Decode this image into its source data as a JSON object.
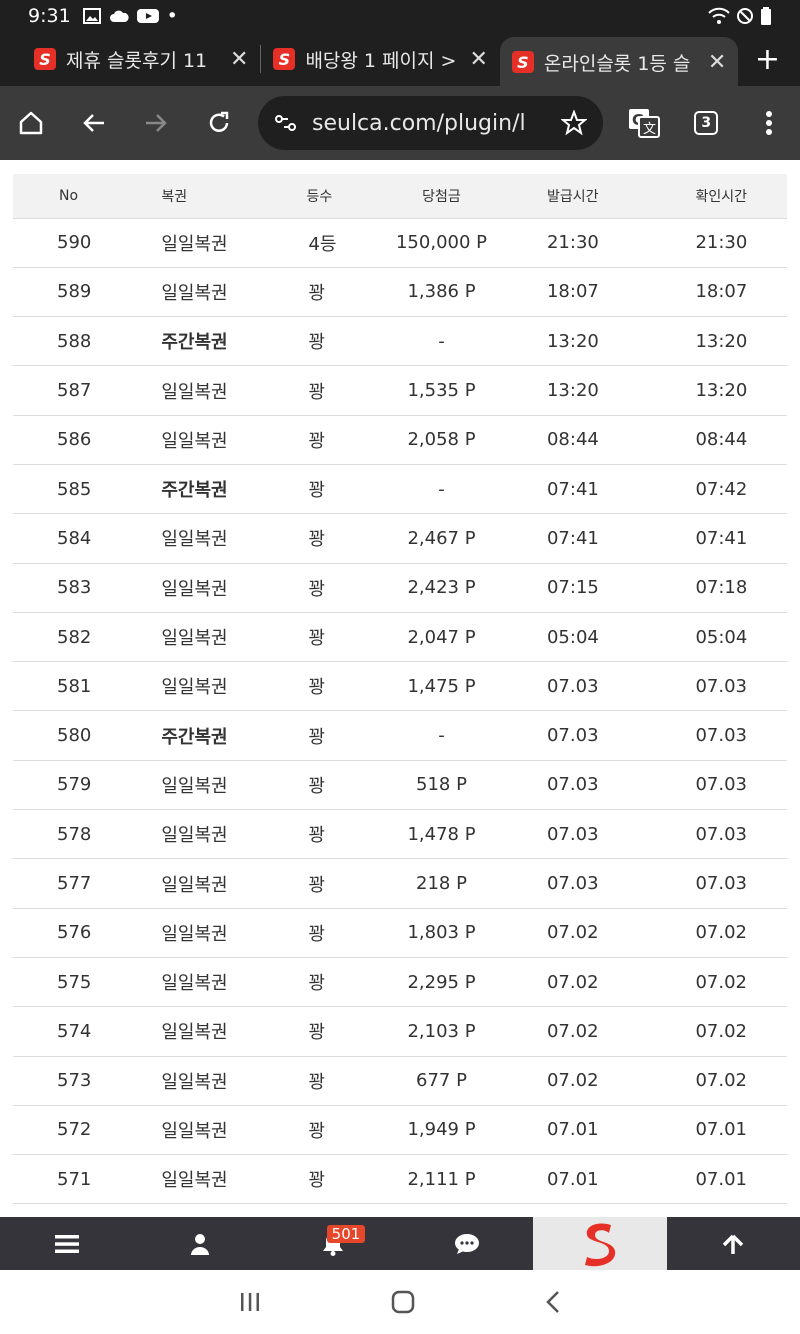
{
  "status_bar": {
    "time": "9:31"
  },
  "tabs": [
    {
      "title": "제휴 슬롯후기 11",
      "active": false
    },
    {
      "title": "배당왕 1 페이지 >",
      "active": false
    },
    {
      "title": "온라인슬롯 1등 슬",
      "active": true
    }
  ],
  "toolbar": {
    "url": "seulca.com/plugin/l",
    "tab_count": "3"
  },
  "table": {
    "headers": [
      "No",
      "복권",
      "등수",
      "당첨금",
      "발급시간",
      "확인시간"
    ],
    "rows": [
      {
        "no": "590",
        "type": "일일복권",
        "rank": "4등",
        "prize": "150,000 P",
        "issued": "21:30",
        "checked": "21:30",
        "bold": false
      },
      {
        "no": "589",
        "type": "일일복권",
        "rank": "꽝",
        "prize": "1,386 P",
        "issued": "18:07",
        "checked": "18:07",
        "bold": false
      },
      {
        "no": "588",
        "type": "주간복권",
        "rank": "꽝",
        "prize": "-",
        "issued": "13:20",
        "checked": "13:20",
        "bold": true
      },
      {
        "no": "587",
        "type": "일일복권",
        "rank": "꽝",
        "prize": "1,535 P",
        "issued": "13:20",
        "checked": "13:20",
        "bold": false
      },
      {
        "no": "586",
        "type": "일일복권",
        "rank": "꽝",
        "prize": "2,058 P",
        "issued": "08:44",
        "checked": "08:44",
        "bold": false
      },
      {
        "no": "585",
        "type": "주간복권",
        "rank": "꽝",
        "prize": "-",
        "issued": "07:41",
        "checked": "07:42",
        "bold": true
      },
      {
        "no": "584",
        "type": "일일복권",
        "rank": "꽝",
        "prize": "2,467 P",
        "issued": "07:41",
        "checked": "07:41",
        "bold": false
      },
      {
        "no": "583",
        "type": "일일복권",
        "rank": "꽝",
        "prize": "2,423 P",
        "issued": "07:15",
        "checked": "07:18",
        "bold": false
      },
      {
        "no": "582",
        "type": "일일복권",
        "rank": "꽝",
        "prize": "2,047 P",
        "issued": "05:04",
        "checked": "05:04",
        "bold": false
      },
      {
        "no": "581",
        "type": "일일복권",
        "rank": "꽝",
        "prize": "1,475 P",
        "issued": "07.03",
        "checked": "07.03",
        "bold": false
      },
      {
        "no": "580",
        "type": "주간복권",
        "rank": "꽝",
        "prize": "-",
        "issued": "07.03",
        "checked": "07.03",
        "bold": true
      },
      {
        "no": "579",
        "type": "일일복권",
        "rank": "꽝",
        "prize": "518 P",
        "issued": "07.03",
        "checked": "07.03",
        "bold": false
      },
      {
        "no": "578",
        "type": "일일복권",
        "rank": "꽝",
        "prize": "1,478 P",
        "issued": "07.03",
        "checked": "07.03",
        "bold": false
      },
      {
        "no": "577",
        "type": "일일복권",
        "rank": "꽝",
        "prize": "218 P",
        "issued": "07.03",
        "checked": "07.03",
        "bold": false
      },
      {
        "no": "576",
        "type": "일일복권",
        "rank": "꽝",
        "prize": "1,803 P",
        "issued": "07.02",
        "checked": "07.02",
        "bold": false
      },
      {
        "no": "575",
        "type": "일일복권",
        "rank": "꽝",
        "prize": "2,295 P",
        "issued": "07.02",
        "checked": "07.02",
        "bold": false
      },
      {
        "no": "574",
        "type": "일일복권",
        "rank": "꽝",
        "prize": "2,103 P",
        "issued": "07.02",
        "checked": "07.02",
        "bold": false
      },
      {
        "no": "573",
        "type": "일일복권",
        "rank": "꽝",
        "prize": "677 P",
        "issued": "07.02",
        "checked": "07.02",
        "bold": false
      },
      {
        "no": "572",
        "type": "일일복권",
        "rank": "꽝",
        "prize": "1,949 P",
        "issued": "07.01",
        "checked": "07.01",
        "bold": false
      },
      {
        "no": "571",
        "type": "일일복권",
        "rank": "꽝",
        "prize": "2,111 P",
        "issued": "07.01",
        "checked": "07.01",
        "bold": false
      }
    ]
  },
  "bottom_nav": {
    "items": [
      "menu-icon",
      "user-icon",
      "bell-icon",
      "chat-icon",
      "site-logo",
      "arrow-up-icon"
    ],
    "notification_count": "501"
  },
  "colors": {
    "accent": "#e63027",
    "chrome_dark": "#1f1f1f",
    "toolbar": "#3b3b3b",
    "nav_bg": "#34343a",
    "badge": "#e6462a"
  }
}
